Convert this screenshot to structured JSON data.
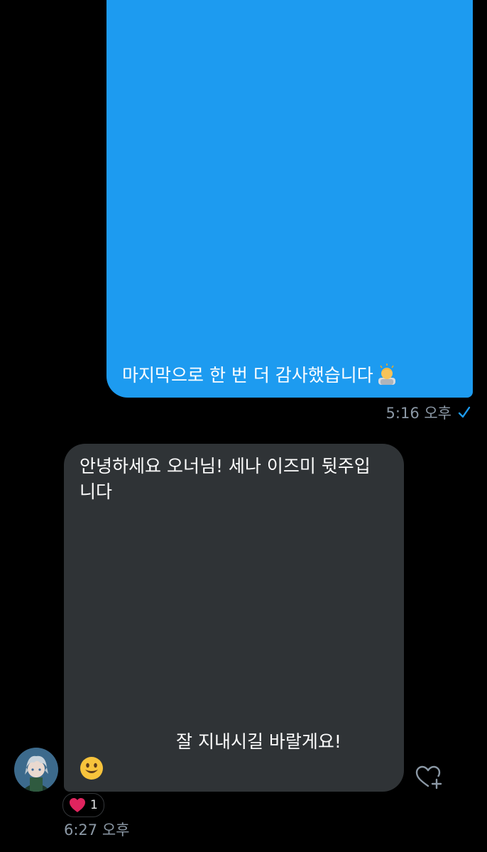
{
  "messages": {
    "sent": {
      "text": "마지막으로 한 번 더 감사했습니다",
      "emoji": "person-bowing-emoji",
      "time": "5:16 오후",
      "status_icon": "check-icon",
      "bubble_color": "#1d9bf0"
    },
    "received": {
      "text_top": "안녕하세요 오너님! 세나 이즈미 뒷주입니다",
      "text_bottom": "잘 지내시길 바랄게요!",
      "emoji": "smiling-face-emoji",
      "time": "6:27 오후",
      "bubble_color": "#2f3336",
      "reaction": {
        "icon": "red-heart-icon",
        "count": "1"
      }
    }
  },
  "colors": {
    "background": "#000000",
    "meta_text": "#8b98a5",
    "accent": "#1d9bf0"
  }
}
